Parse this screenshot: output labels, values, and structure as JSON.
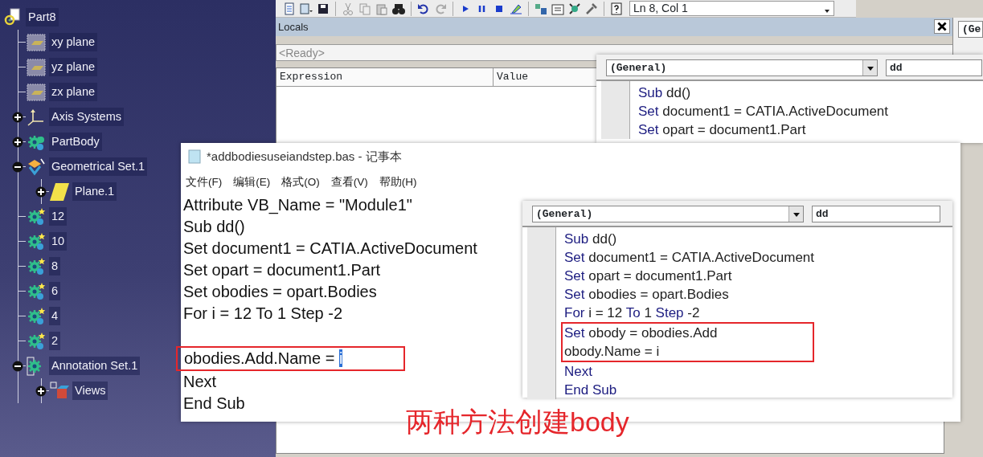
{
  "tree": {
    "label": "Part8",
    "kind": "part",
    "children": [
      {
        "label": "xy plane",
        "kind": "plane"
      },
      {
        "label": "yz plane",
        "kind": "plane"
      },
      {
        "label": "zx plane",
        "kind": "plane"
      },
      {
        "label": "Axis Systems",
        "kind": "axis",
        "expanded": false
      },
      {
        "label": "PartBody",
        "kind": "body",
        "expanded": false
      },
      {
        "label": "Geometrical Set.1",
        "kind": "geoset",
        "expanded": true,
        "children": [
          {
            "label": "Plane.1",
            "kind": "sketch_plane",
            "expanded": false
          }
        ]
      },
      {
        "label": "12",
        "kind": "new_body"
      },
      {
        "label": "10",
        "kind": "new_body"
      },
      {
        "label": "8",
        "kind": "new_body"
      },
      {
        "label": "6",
        "kind": "new_body"
      },
      {
        "label": "4",
        "kind": "new_body"
      },
      {
        "label": "2",
        "kind": "new_body"
      },
      {
        "label": "Annotation Set.1",
        "kind": "annotation",
        "expanded": true,
        "children": [
          {
            "label": "Views",
            "kind": "views",
            "expanded": false
          }
        ]
      }
    ]
  },
  "vba": {
    "toolbar": {
      "position": "Ln 8, Col 1"
    },
    "locals": {
      "title": "Locals",
      "status": "<Ready>",
      "columns": [
        "Expression",
        "Value"
      ]
    },
    "back_code_window": {
      "object": "(General)",
      "procedure": "dd",
      "lines": [
        {
          "kind": "code",
          "segments": [
            {
              "text": "Sub",
              "kind": "keyword"
            },
            {
              "text": " dd()",
              "kind": "plain"
            }
          ]
        },
        {
          "kind": "code",
          "segments": [
            {
              "text": "Set",
              "kind": "keyword"
            },
            {
              "text": " document1 = CATIA.ActiveDocument",
              "kind": "plain"
            }
          ]
        },
        {
          "kind": "code",
          "segments": [
            {
              "text": "Set",
              "kind": "keyword"
            },
            {
              "text": " opart = document1.Part",
              "kind": "plain"
            }
          ]
        }
      ]
    },
    "side_window": {
      "object": "(Ge"
    }
  },
  "notepad": {
    "title": "*addbodiesuseiandstep.bas - 记事本",
    "menu": [
      "文件(F)",
      "编辑(E)",
      "格式(O)",
      "查看(V)",
      "帮助(H)"
    ],
    "lines": [
      {
        "kind": "code",
        "boxed": false,
        "segments": [
          {
            "text": "Attribute VB_Name = \"Module1\"",
            "kind": "plain"
          }
        ]
      },
      {
        "kind": "code",
        "boxed": false,
        "segments": [
          {
            "text": "Sub dd()",
            "kind": "plain"
          }
        ]
      },
      {
        "kind": "code",
        "boxed": false,
        "segments": [
          {
            "text": "Set document1 = CATIA.ActiveDocument",
            "kind": "plain"
          }
        ]
      },
      {
        "kind": "code",
        "boxed": false,
        "segments": [
          {
            "text": "Set opart = document1.Part",
            "kind": "plain"
          }
        ]
      },
      {
        "kind": "code",
        "boxed": false,
        "segments": [
          {
            "text": "Set obodies = opart.Bodies",
            "kind": "plain"
          }
        ]
      },
      {
        "kind": "code",
        "boxed": false,
        "segments": [
          {
            "text": "For i = 12 To 1 Step -2",
            "kind": "plain"
          }
        ]
      },
      {
        "kind": "blank",
        "boxed": false
      },
      {
        "kind": "code",
        "boxed": true,
        "segments": [
          {
            "text": "obodies.Add.Name = ",
            "kind": "plain"
          },
          {
            "text": "i",
            "kind": "selected"
          }
        ]
      },
      {
        "kind": "code",
        "boxed": false,
        "segments": [
          {
            "text": "Next",
            "kind": "plain"
          }
        ]
      },
      {
        "kind": "code",
        "boxed": false,
        "segments": [
          {
            "text": "End Sub",
            "kind": "plain"
          }
        ]
      }
    ]
  },
  "code_window": {
    "object": "(General)",
    "procedure": "dd",
    "lines": [
      {
        "kind": "code",
        "boxed": false,
        "segments": [
          {
            "text": "Sub",
            "kind": "keyword"
          },
          {
            "text": " dd()",
            "kind": "plain"
          }
        ]
      },
      {
        "kind": "code",
        "boxed": false,
        "segments": [
          {
            "text": "Set",
            "kind": "keyword"
          },
          {
            "text": " document1 = CATIA.ActiveDocument",
            "kind": "plain"
          }
        ]
      },
      {
        "kind": "code",
        "boxed": false,
        "segments": [
          {
            "text": "Set",
            "kind": "keyword"
          },
          {
            "text": " opart = document1.Part",
            "kind": "plain"
          }
        ]
      },
      {
        "kind": "code",
        "boxed": false,
        "segments": [
          {
            "text": "Set",
            "kind": "keyword"
          },
          {
            "text": " obodies = opart.Bodies",
            "kind": "plain"
          }
        ]
      },
      {
        "kind": "code",
        "boxed": false,
        "segments": [
          {
            "text": "For",
            "kind": "keyword"
          },
          {
            "text": " i = 12 ",
            "kind": "plain"
          },
          {
            "text": "To",
            "kind": "keyword"
          },
          {
            "text": " 1 ",
            "kind": "plain"
          },
          {
            "text": "Step",
            "kind": "keyword"
          },
          {
            "text": " -2",
            "kind": "plain"
          }
        ]
      },
      {
        "kind": "code",
        "boxed": true,
        "segments": [
          {
            "text": "Set",
            "kind": "keyword"
          },
          {
            "text": " obody = obodies.Add",
            "kind": "plain"
          }
        ]
      },
      {
        "kind": "code",
        "boxed": true,
        "segments": [
          {
            "text": "obody.Name = i",
            "kind": "plain"
          }
        ]
      },
      {
        "kind": "code",
        "boxed": false,
        "segments": [
          {
            "text": "Next",
            "kind": "keyword"
          }
        ]
      },
      {
        "kind": "code",
        "boxed": false,
        "segments": [
          {
            "text": "End Sub",
            "kind": "keyword"
          }
        ]
      }
    ]
  },
  "annotation": "两种方法创建body"
}
